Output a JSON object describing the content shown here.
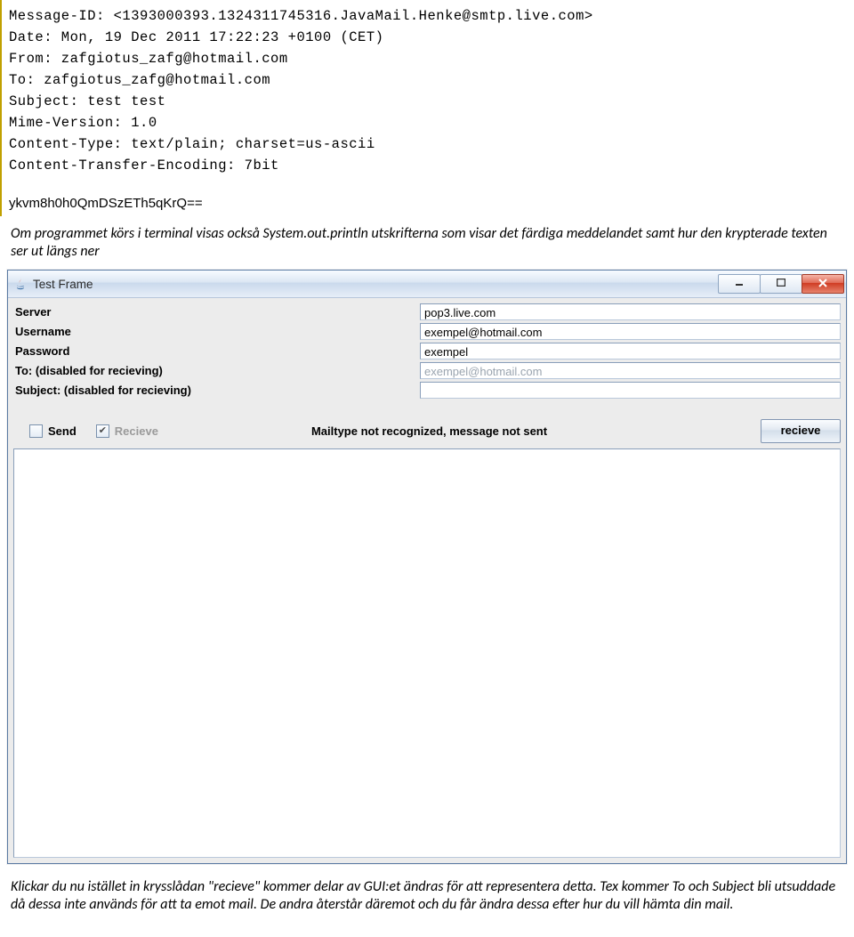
{
  "email_headers": {
    "message_id": "Message-ID: <1393000393.1324311745316.JavaMail.Henke@smtp.live.com>",
    "date": "Date: Mon, 19 Dec 2011 17:22:23 +0100 (CET)",
    "from": "From: zafgiotus_zafg@hotmail.com",
    "to": "To: zafgiotus_zafg@hotmail.com",
    "subject": "Subject: test test",
    "mime": "Mime-Version: 1.0",
    "ctype": "Content-Type: text/plain; charset=us-ascii",
    "cenc": "Content-Transfer-Encoding: 7bit"
  },
  "encoded_line": "ykvm8h0h0QmDSzETh5qKrQ==",
  "doc_para1": "Om programmet körs i terminal visas också System.out.println utskrifterna som visar det färdiga meddelandet samt hur den krypterade texten ser ut längs ner",
  "window": {
    "title": "Test Frame",
    "fields": {
      "server_label": "Server",
      "server_value": "pop3.live.com",
      "username_label": "Username",
      "username_value": "exempel@hotmail.com",
      "password_label": "Password",
      "password_value": "exempel",
      "to_label": "To: (disabled for recieving)",
      "to_value": "exempel@hotmail.com",
      "subject_label": "Subject: (disabled for recieving)",
      "subject_value": ""
    },
    "send_label": "Send",
    "recieve_label": "Recieve",
    "status": "Mailtype not recognized, message not sent",
    "recieve_button": "recieve"
  },
  "doc_para2": "Klickar du nu istället in krysslådan \"recieve\" kommer delar av GUI:et ändras för att representera detta. Tex kommer To och Subject bli utsuddade då dessa inte används för att ta emot mail. De andra återstår däremot och du får ändra dessa efter hur du vill hämta din mail."
}
